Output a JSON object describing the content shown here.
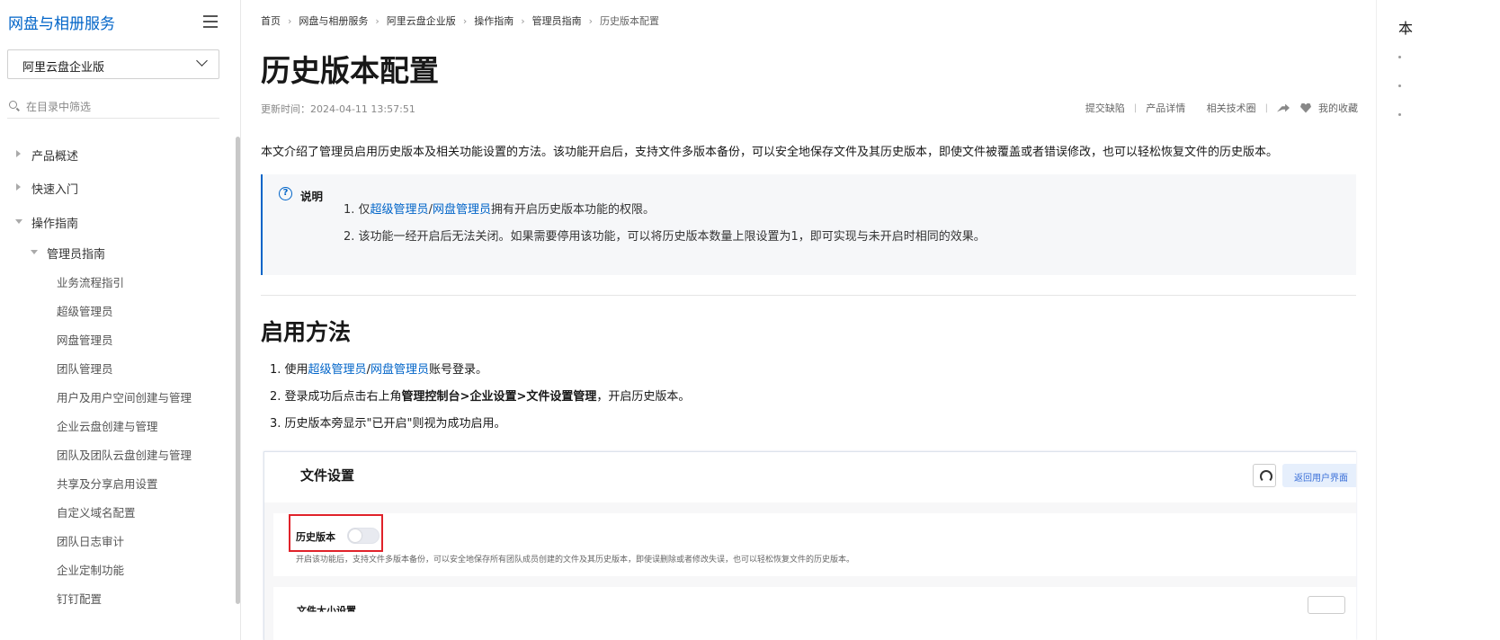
{
  "sidebar": {
    "title": "网盘与相册服务",
    "product_select": "阿里云盘企业版",
    "filter_placeholder": "在目录中筛选",
    "items": [
      {
        "label": "产品概述"
      },
      {
        "label": "快速入门"
      },
      {
        "label": "操作指南"
      },
      {
        "label": "管理员指南"
      },
      {
        "label": "业务流程指引"
      },
      {
        "label": "超级管理员"
      },
      {
        "label": "网盘管理员"
      },
      {
        "label": "团队管理员"
      },
      {
        "label": "用户及用户空间创建与管理"
      },
      {
        "label": "企业云盘创建与管理"
      },
      {
        "label": "团队及团队云盘创建与管理"
      },
      {
        "label": "共享及分享启用设置"
      },
      {
        "label": "自定义域名配置"
      },
      {
        "label": "团队日志审计"
      },
      {
        "label": "企业定制功能"
      },
      {
        "label": "钉钉配置"
      }
    ]
  },
  "breadcrumb": [
    "首页",
    "网盘与相册服务",
    "阿里云盘企业版",
    "操作指南",
    "管理员指南",
    "历史版本配置"
  ],
  "page": {
    "title": "历史版本配置",
    "updated": "更新时间：2024-04-11 13:57:51",
    "actions": [
      "提交缺陷",
      "产品详情",
      "相关技术圈",
      "我的收藏"
    ],
    "intro": "本文介绍了管理员启用历史版本及相关功能设置的方法。该功能开启后，支持文件多版本备份，可以安全地保存文件及其历史版本，即使文件被覆盖或者错误修改，也可以轻松恢复文件的历史版本。"
  },
  "note": {
    "icon": "?",
    "title": "说明",
    "line1_prefix": "1. 仅",
    "line1_link1": "超级管理员",
    "line1_slash": "/",
    "line1_link2": "网盘管理员",
    "line1_suffix": "拥有开启历史版本功能的权限。",
    "line2": "2. 该功能一经开启后无法关闭。如果需要停用该功能，可以将历史版本数量上限设置为1，即可实现与未开启时相同的效果。"
  },
  "section": {
    "title": "启用方法",
    "step1_prefix": "1. 使用",
    "step1_link1": "超级管理员",
    "step1_slash": "/",
    "step1_link2": "网盘管理员",
    "step1_suffix": "账号登录。",
    "step2_prefix": "2. 登录成功后点击右上角",
    "step2_bold": "管理控制台>企业设置>文件设置管理",
    "step2_suffix": "，开启历史版本。",
    "step3": "3. 历史版本旁显示\"已开启\"则视为成功启用。"
  },
  "screenshot": {
    "title": "文件设置",
    "back_button": "返回用户界面",
    "setting_label": "历史版本",
    "setting_desc": "开启该功能后，支持文件多版本备份，可以安全地保存所有团队成员创建的文件及其历史版本，即使误删除或者修改失误，也可以轻松恢复文件的历史版本。",
    "cut_label": "文件大小设置"
  },
  "toc": {
    "title": "本"
  },
  "colors": {
    "link": "#0064c8",
    "highlight": "#e0222a"
  }
}
